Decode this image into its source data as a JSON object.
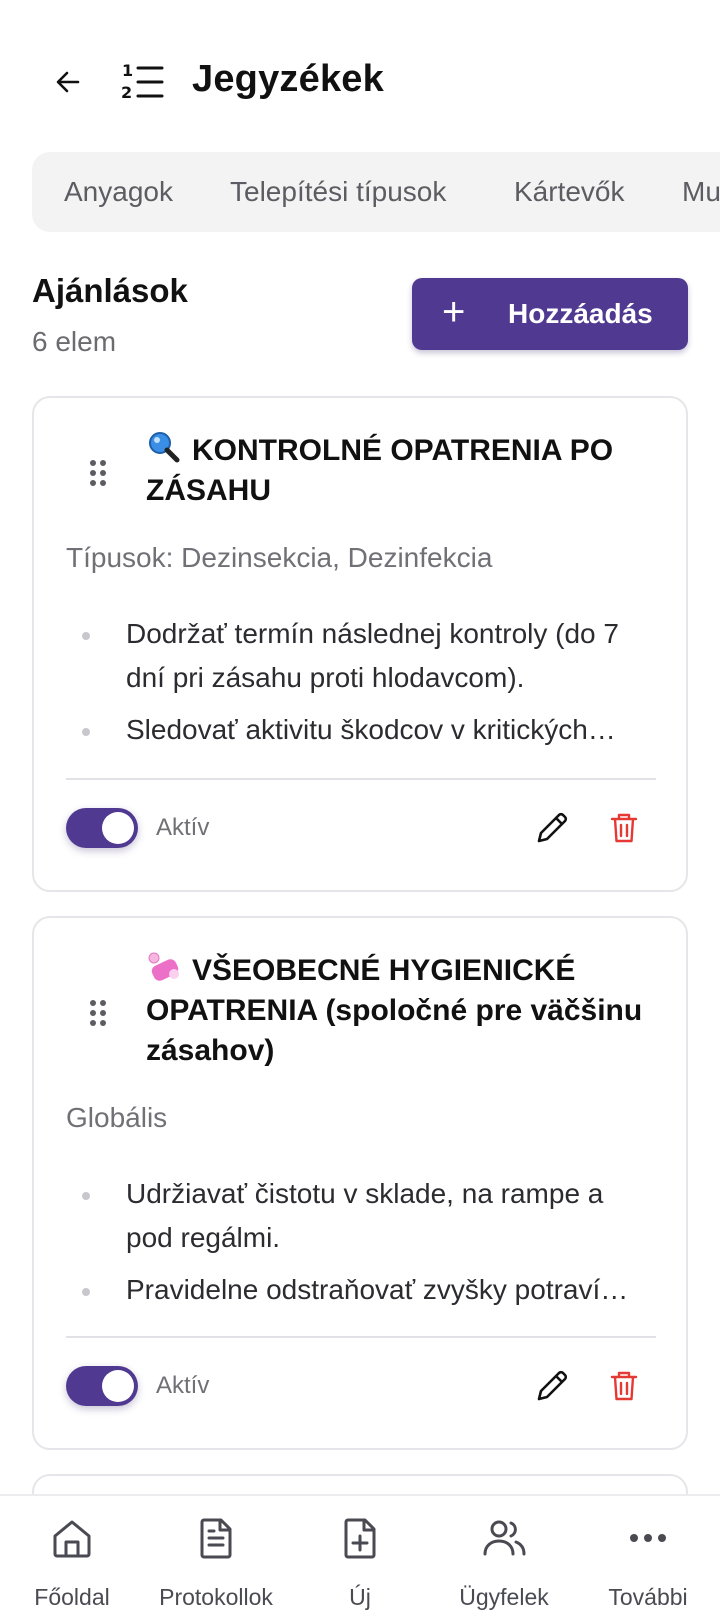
{
  "header": {
    "title": "Jegyzékek"
  },
  "tabs": [
    "Anyagok",
    "Telepítési típusok",
    "Kártevők",
    "Mu"
  ],
  "section": {
    "title": "Ajánlások",
    "count": "6 elem",
    "add_label": "Hozzáadás"
  },
  "cards": [
    {
      "icon": "magnifier-icon",
      "title": "KONTROLNÉ OPATRENIA PO ZÁSAHU",
      "subtitle": "Típusok: Dezinsekcia, Dezinfekcia",
      "bullets": [
        "Dodržať termín následnej kontroly (do 7 dní pri zásahu proti hlodavcom).",
        "Sledovať aktivitu škodcov v kritických…"
      ],
      "status": "Aktív",
      "active": true
    },
    {
      "icon": "soap-icon",
      "title": "VŠEOBECNÉ HYGIENICKÉ OPATRENIA (spoločné pre väčšinu zásahov)",
      "subtitle": "Globális",
      "bullets": [
        "Udržiavať čistotu v sklade, na rampe a pod regálmi.",
        "Pravidelne odstraňovať zvyšky potraví…"
      ],
      "status": "Aktív",
      "active": true
    }
  ],
  "nav": [
    "Főoldal",
    "Protokollok",
    "Új",
    "Ügyfelek",
    "További"
  ],
  "colors": {
    "accent": "#503a91",
    "danger": "#e53935"
  }
}
